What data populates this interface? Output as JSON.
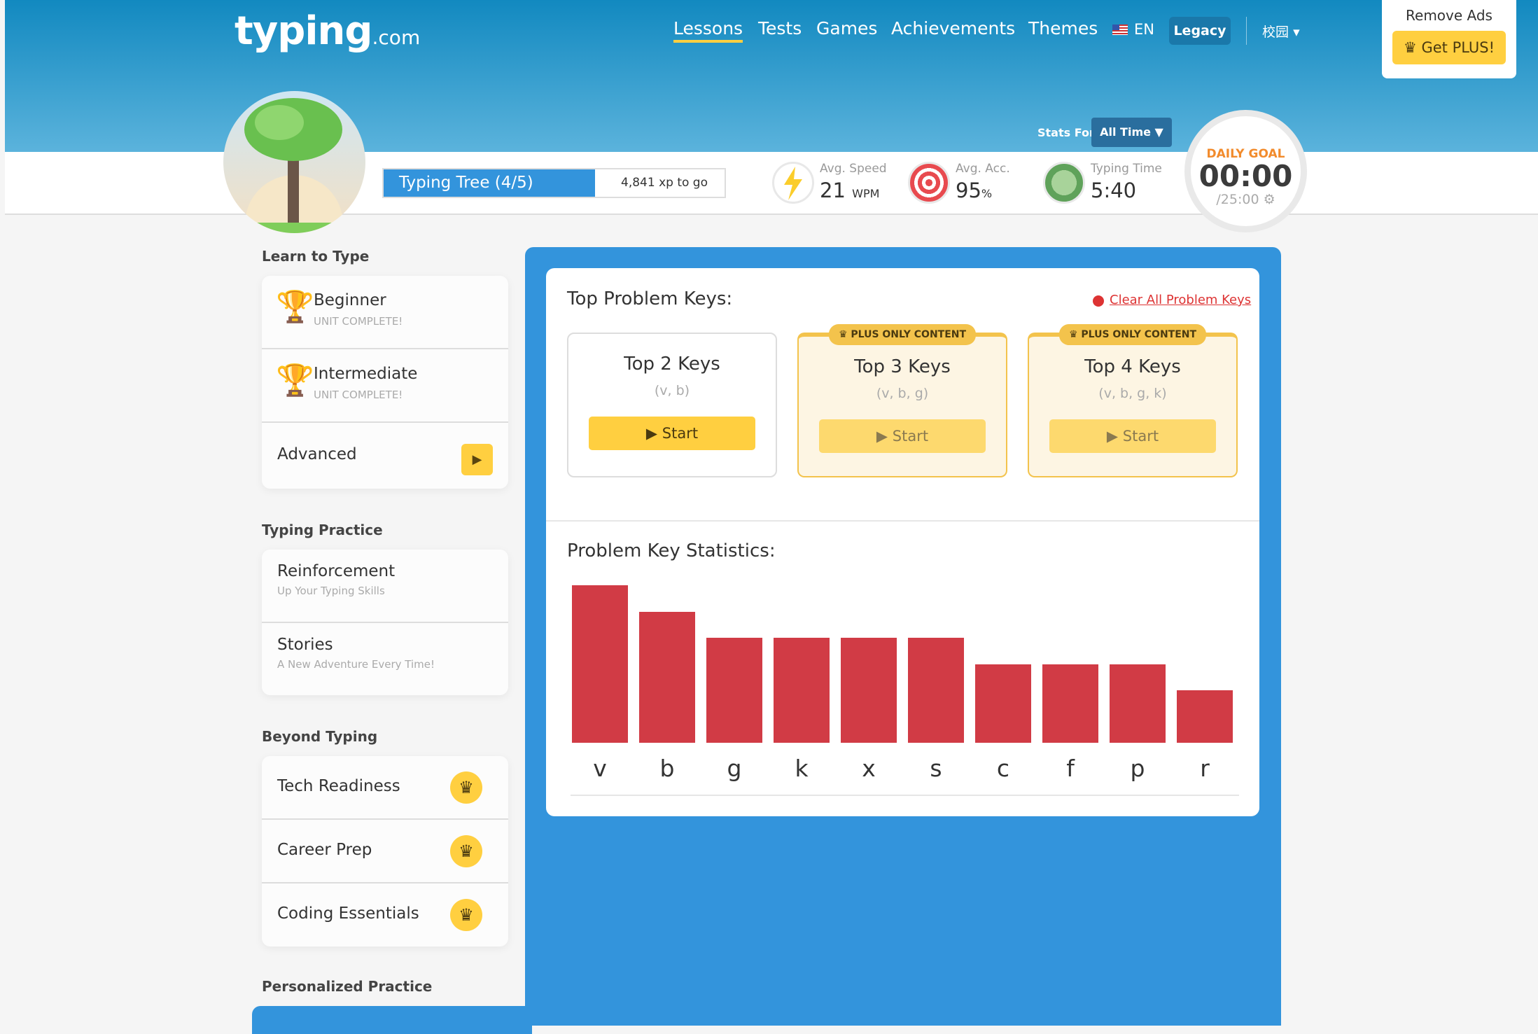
{
  "header": {
    "logo": "typing",
    "logo_suffix": ".com",
    "nav": [
      "Lessons",
      "Tests",
      "Games",
      "Achievements",
      "Themes"
    ],
    "language": "EN",
    "legacy": "Legacy",
    "school": "校园",
    "remove_ads": "Remove Ads",
    "get_plus": "Get PLUS!"
  },
  "profile": {
    "level": "Typing Tree (4/5)",
    "xp_to_go": "4,841 xp to go",
    "level_progress_percent": 62
  },
  "stats": {
    "stats_for_label": "Stats For:",
    "stats_for_value": "All Time",
    "speed_label": "Avg. Speed",
    "speed_value": "21",
    "speed_unit": "WPM",
    "acc_label": "Avg. Acc.",
    "acc_value": "95",
    "acc_unit": "%",
    "time_label": "Typing Time",
    "time_value": "5:40"
  },
  "daily_goal": {
    "label": "DAILY GOAL",
    "value": "00:00",
    "target": "/25:00"
  },
  "sidebar": {
    "learn_label": "Learn to Type",
    "learn": [
      {
        "name": "Beginner",
        "sub": "UNIT COMPLETE!"
      },
      {
        "name": "Intermediate",
        "sub": "UNIT COMPLETE!"
      },
      {
        "name": "Advanced"
      }
    ],
    "practice_label": "Typing Practice",
    "practice": [
      {
        "name": "Reinforcement",
        "sub": "Up Your Typing Skills"
      },
      {
        "name": "Stories",
        "sub": "A New Adventure Every Time!"
      }
    ],
    "beyond_label": "Beyond Typing",
    "beyond": [
      {
        "name": "Tech Readiness"
      },
      {
        "name": "Career Prep"
      },
      {
        "name": "Coding Essentials"
      }
    ],
    "personalized_label": "Personalized Practice"
  },
  "main": {
    "title": "Top Problem Keys:",
    "clear": "Clear All Problem Keys",
    "cards": [
      {
        "title": "Top 2 Keys",
        "keys": "(v, b)",
        "start": "Start"
      },
      {
        "title": "Top 3 Keys",
        "keys": "(v, b, g)",
        "start": "Start",
        "badge": "PLUS ONLY CONTENT"
      },
      {
        "title": "Top 4 Keys",
        "keys": "(v, b, g, k)",
        "start": "Start",
        "badge": "PLUS ONLY CONTENT"
      }
    ],
    "stats_title": "Problem Key Statistics:"
  },
  "chart_data": {
    "type": "bar",
    "categories": [
      "v",
      "b",
      "g",
      "k",
      "x",
      "s",
      "c",
      "f",
      "p",
      "r"
    ],
    "values": [
      6,
      5,
      4,
      4,
      4,
      4,
      3,
      3,
      3,
      2
    ],
    "bar_color": "#d13b45"
  },
  "colors": {
    "accent": "#3394dc",
    "plus": "#ffcf40",
    "bar": "#d13b45"
  }
}
